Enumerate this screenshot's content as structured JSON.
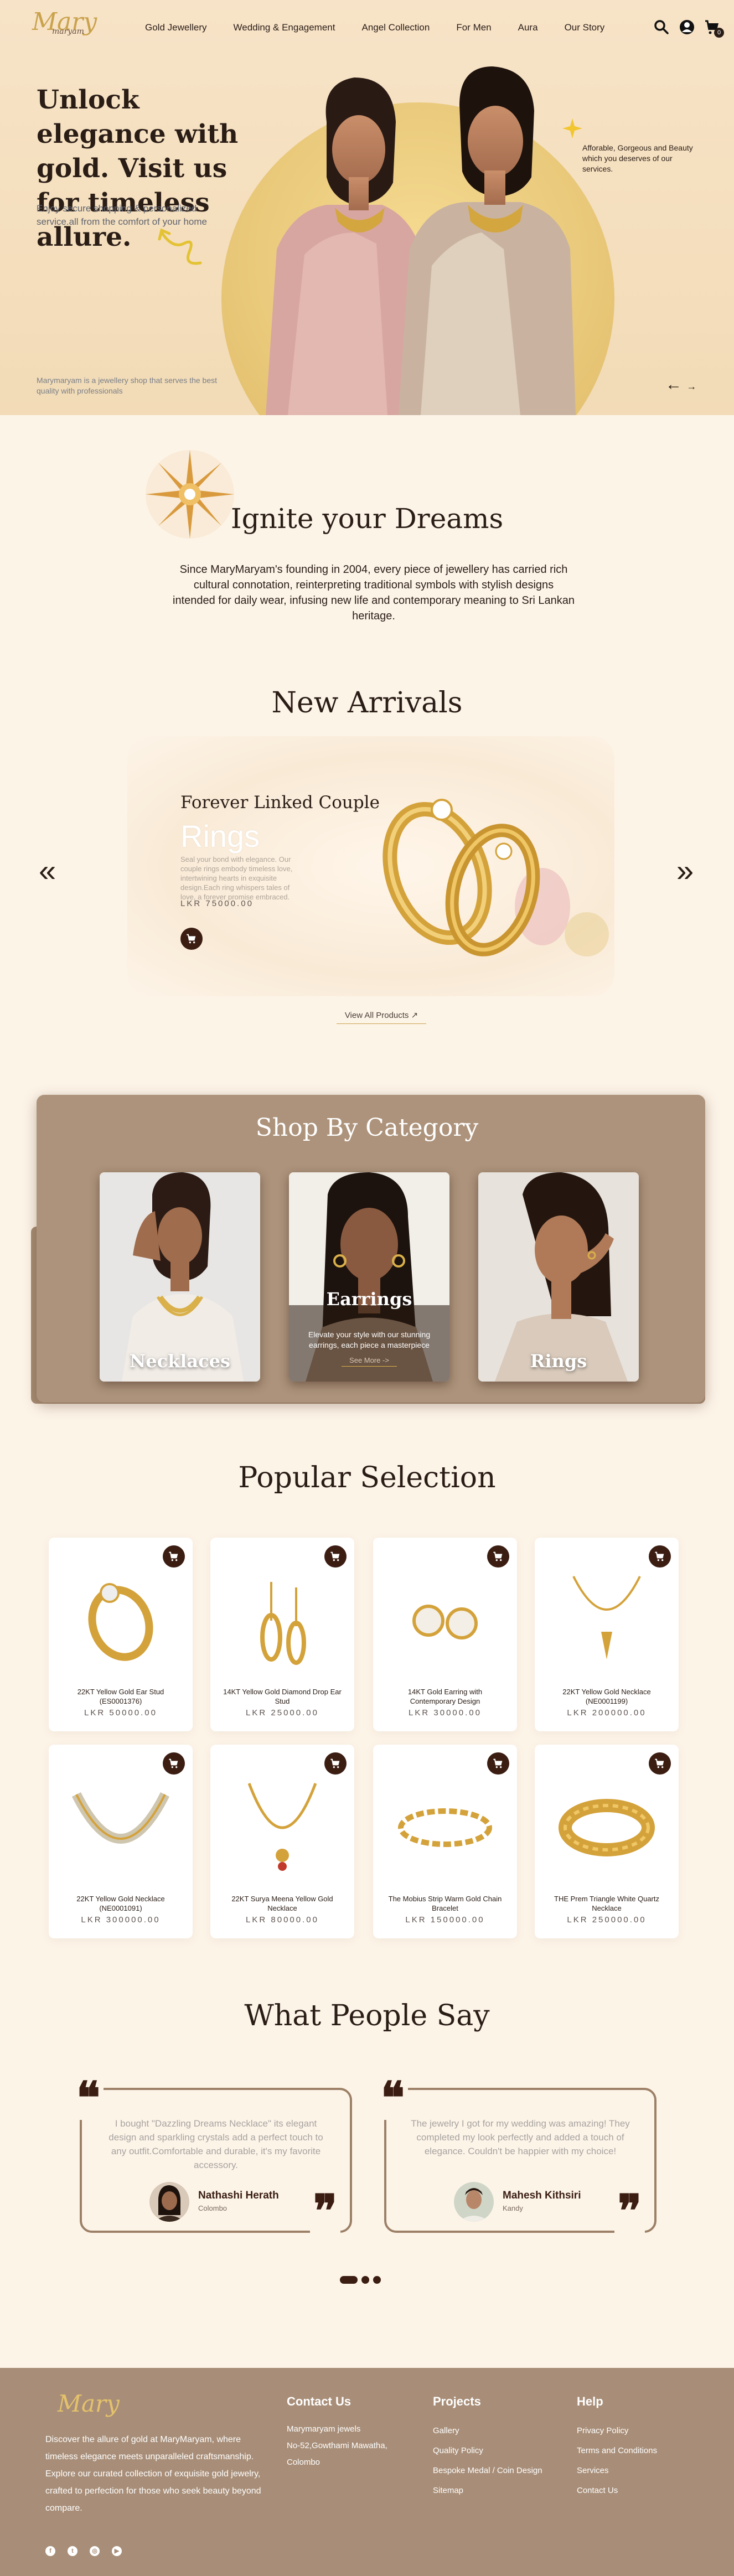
{
  "header": {
    "logo": "Mary",
    "logo_sub": "maryam",
    "nav": [
      "Gold Jewellery",
      "Wedding & Engagement",
      "Angel Collection",
      "For Men",
      "Aura",
      "Our Story"
    ],
    "cart_count": "0"
  },
  "hero": {
    "title": "Unlock elegance with gold. Visit us for timeless allure.",
    "subtitle": "Enjoy secure shopping & personalized service.all from the comfort of your home",
    "side_text": "Afforable, Gorgeous and Beauty which you deserves of our services.",
    "footer_text": "Marymaryam is a jewellery shop that serves the best quality with professionals"
  },
  "ignite": {
    "title": "Ignite your Dreams",
    "text": "Since MaryMaryam's founding in 2004, every piece of jewellery has carried rich cultural connotation, reinterpreting traditional symbols with stylish designs intended for daily wear, infusing new life and contemporary meaning to Sri Lankan heritage."
  },
  "new_arrivals": {
    "title": "New Arrivals",
    "product_name": "Forever Linked Couple",
    "product_word": "Rings",
    "description": "Seal your bond with elegance. Our couple rings embody timeless love, intertwining hearts in exquisite design.Each ring whispers tales of love, a forever promise embraced.",
    "price": "LKR 75000.00",
    "view_all": "View All Products ↗"
  },
  "category": {
    "title": "Shop By Category",
    "items": [
      {
        "label": "Necklaces"
      },
      {
        "label": "Earrings",
        "desc": "Elevate your style with our stunning earrings, each piece a masterpiece",
        "cta": "See More ->"
      },
      {
        "label": "Rings"
      }
    ]
  },
  "popular": {
    "title": "Popular Selection",
    "items": [
      {
        "name": "22KT Yellow Gold Ear Stud (ES0001376)",
        "price": "LKR 50000.00",
        "icon": "ring"
      },
      {
        "name": "14KT Yellow Gold Diamond Drop Ear Stud",
        "price": "LKR 25000.00",
        "icon": "drop-earring"
      },
      {
        "name": "14KT Gold Earring with Contemporary Design",
        "price": "LKR 30000.00",
        "icon": "stud-earring"
      },
      {
        "name": "22KT Yellow Gold Necklace (NE0001199)",
        "price": "LKR 200000.00",
        "icon": "pendant-necklace"
      },
      {
        "name": "22KT Yellow Gold Necklace (NE0001091)",
        "price": "LKR 300000.00",
        "icon": "diamond-necklace"
      },
      {
        "name": "22KT Surya Meena Yellow Gold Necklace",
        "price": "LKR 80000.00",
        "icon": "chain-necklace"
      },
      {
        "name": "The Mobius Strip Warm Gold Chain Bracelet",
        "price": "LKR 150000.00",
        "icon": "bracelet"
      },
      {
        "name": "THE Prem Triangle White Quartz Necklace",
        "price": "LKR 250000.00",
        "icon": "chunky-bracelet"
      }
    ]
  },
  "testimonials": {
    "title": "What People Say",
    "items": [
      {
        "text": "I bought \"Dazzling Dreams Necklace\" its elegant design and sparkling crystals add a perfect touch to any outfit.Comfortable and durable, it's my favorite accessory.",
        "name": "Nathashi Herath",
        "place": "Colombo"
      },
      {
        "text": "The jewelry I got for my wedding was amazing! They completed my look perfectly and added a touch of elegance. Couldn't be happier with my choice!",
        "name": "Mahesh Kithsiri",
        "place": "Kandy"
      }
    ]
  },
  "footer": {
    "logo": "Mary",
    "about": "Discover the allure of gold at MaryMaryam, where timeless elegance meets unparalleled craftsmanship. Explore our curated collection of exquisite gold jewelry, crafted to perfection for those who seek beauty beyond compare.",
    "contact": {
      "title": "Contact Us",
      "lines": [
        "Marymaryam jewels",
        "No-52,Gowthami Mawatha,",
        "Colombo"
      ]
    },
    "projects": {
      "title": "Projects",
      "links": [
        "Gallery",
        "Quality Policy",
        "Bespoke Medal / Coin Design",
        "Sitemap"
      ]
    },
    "help": {
      "title": "Help",
      "links": [
        "Privacy Policy",
        "Terms and Conditions",
        "Services",
        "Contact Us"
      ]
    },
    "social": [
      "facebook-icon",
      "twitter-icon",
      "instagram-icon",
      "youtube-icon"
    ]
  },
  "colors": {
    "brand_dark": "#3b1d12",
    "gold": "#c9a24b",
    "taupe": "#a88e78",
    "cream": "#fdf4e8"
  }
}
